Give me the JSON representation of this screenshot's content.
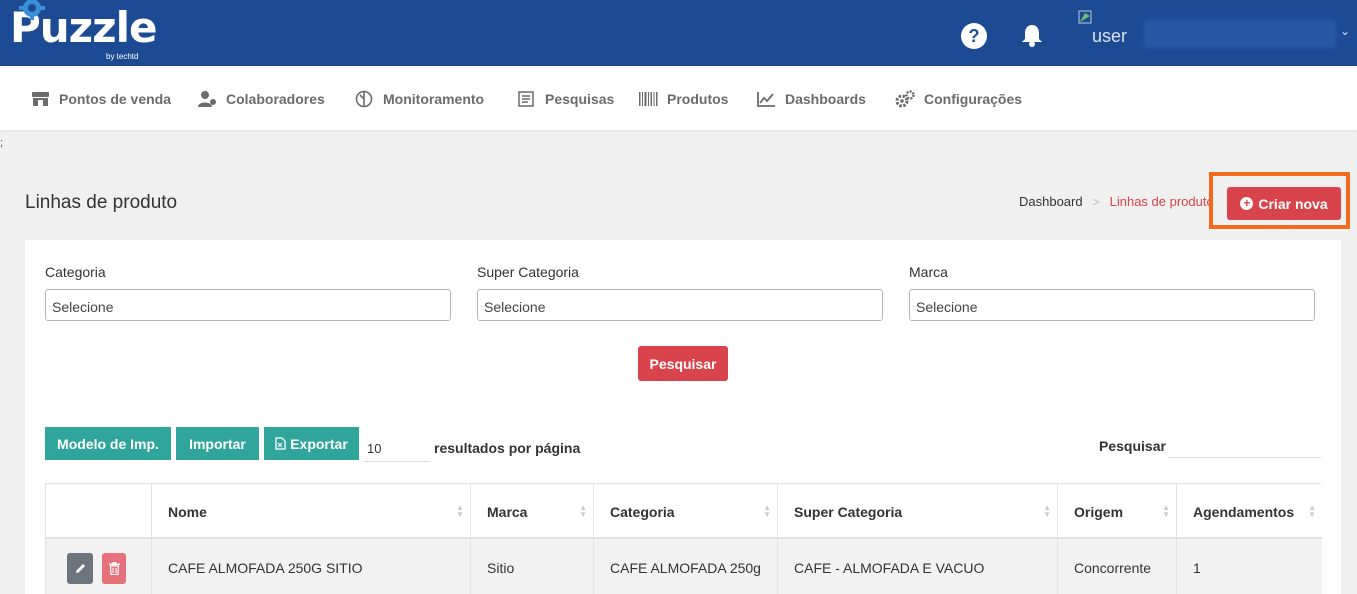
{
  "header": {
    "logo_text": "Puzzle",
    "logo_sub": "by techtd",
    "help_glyph": "?",
    "user_name": "user",
    "user_caret": "⌄"
  },
  "nav": {
    "items": [
      {
        "label": "Pontos de venda",
        "icon": "store-icon"
      },
      {
        "label": "Colaboradores",
        "icon": "users-icon"
      },
      {
        "label": "Monitoramento",
        "icon": "monitor-icon"
      },
      {
        "label": "Pesquisas",
        "icon": "survey-icon"
      },
      {
        "label": "Produtos",
        "icon": "barcode-icon"
      },
      {
        "label": "Dashboards",
        "icon": "chart-icon"
      },
      {
        "label": "Configurações",
        "icon": "gears-icon"
      }
    ]
  },
  "stray_text": ";",
  "page": {
    "title": "Linhas de produto",
    "breadcrumb": {
      "home": "Dashboard",
      "sep": ">",
      "current": "Linhas de produto"
    },
    "create_button": "Criar nova",
    "create_plus": "+"
  },
  "filters": {
    "categoria": {
      "label": "Categoria",
      "value": "Selecione"
    },
    "super_categoria": {
      "label": "Super Categoria",
      "value": "Selecione"
    },
    "marca": {
      "label": "Marca",
      "value": "Selecione"
    },
    "search_button": "Pesquisar"
  },
  "toolbar": {
    "modelo_button": "Modelo de Imp.",
    "importar_button": "Importar",
    "exportar_button": "Exportar",
    "per_page_value": "10",
    "per_page_label": "resultados por página",
    "search_label": "Pesquisar"
  },
  "table": {
    "columns": [
      "",
      "Nome",
      "Marca",
      "Categoria",
      "Super Categoria",
      "Origem",
      "Agendamentos"
    ],
    "rows": [
      {
        "nome": "CAFE ALMOFADA 250G SITIO",
        "marca": "Sitio",
        "categoria": "CAFE ALMOFADA 250g",
        "super_categoria": "CAFE - ALMOFADA E VACUO",
        "origem": "Concorrente",
        "agendamentos": "1"
      }
    ]
  },
  "colors": {
    "topbar": "#1c4b94",
    "primary_red": "#d9434b",
    "teal": "#2fa59b",
    "highlight_orange": "#f26a1b"
  }
}
